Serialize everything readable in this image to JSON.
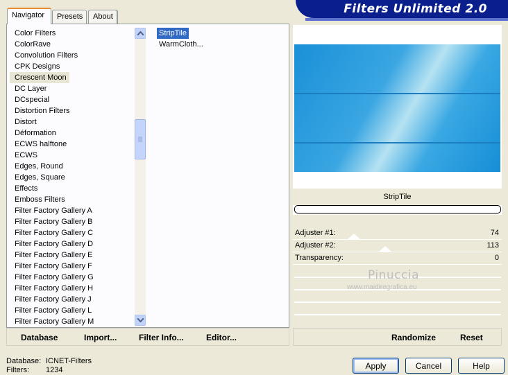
{
  "tabs": [
    "Navigator",
    "Presets",
    "About"
  ],
  "banner": {
    "title": "Filters Unlimited 2.0"
  },
  "categories": [
    "Color Filters",
    "ColorRave",
    "Convolution Filters",
    "CPK Designs",
    "Crescent Moon",
    "DC Layer",
    "DCspecial",
    "Distortion Filters",
    "Distort",
    "Déformation",
    "ECWS halftone",
    "ECWS",
    "Edges, Round",
    "Edges, Square",
    "Effects",
    "Emboss Filters",
    "Filter Factory Gallery A",
    "Filter Factory Gallery B",
    "Filter Factory Gallery C",
    "Filter Factory Gallery D",
    "Filter Factory Gallery E",
    "Filter Factory Gallery F",
    "Filter Factory Gallery G",
    "Filter Factory Gallery H",
    "Filter Factory Gallery J",
    "Filter Factory Gallery L",
    "Filter Factory Gallery M"
  ],
  "selected_category": "Crescent Moon",
  "filters": [
    "StripTile",
    "WarmCloth..."
  ],
  "selected_filter": "StripTile",
  "preview": {
    "filter_name": "StripTile"
  },
  "adjusters": [
    {
      "label": "Adjuster #1:",
      "value": "74"
    },
    {
      "label": "Adjuster #2:",
      "value": "113"
    },
    {
      "label": "Transparency:",
      "value": "0"
    }
  ],
  "watermark": {
    "line1": "Pinuccia",
    "line2": "www.maidiregrafica.eu"
  },
  "left_buttons": {
    "database": "Database",
    "import": "Import...",
    "filter_info": "Filter Info...",
    "editor": "Editor..."
  },
  "right_buttons": {
    "randomize": "Randomize",
    "reset": "Reset"
  },
  "status": {
    "database_label": "Database:",
    "database_value": "ICNET-Filters",
    "filters_label": "Filters:",
    "filters_value": "1234"
  },
  "dialog_buttons": {
    "apply": "Apply",
    "cancel": "Cancel",
    "help": "Help"
  },
  "icons": {
    "scroll_up": "arrow-up-icon",
    "scroll_down": "arrow-down-icon",
    "grip": "grip-icon"
  },
  "colors": {
    "selection": "#316ac5",
    "banner": "#0a1f8c",
    "tab_highlight": "#e68b2c"
  }
}
